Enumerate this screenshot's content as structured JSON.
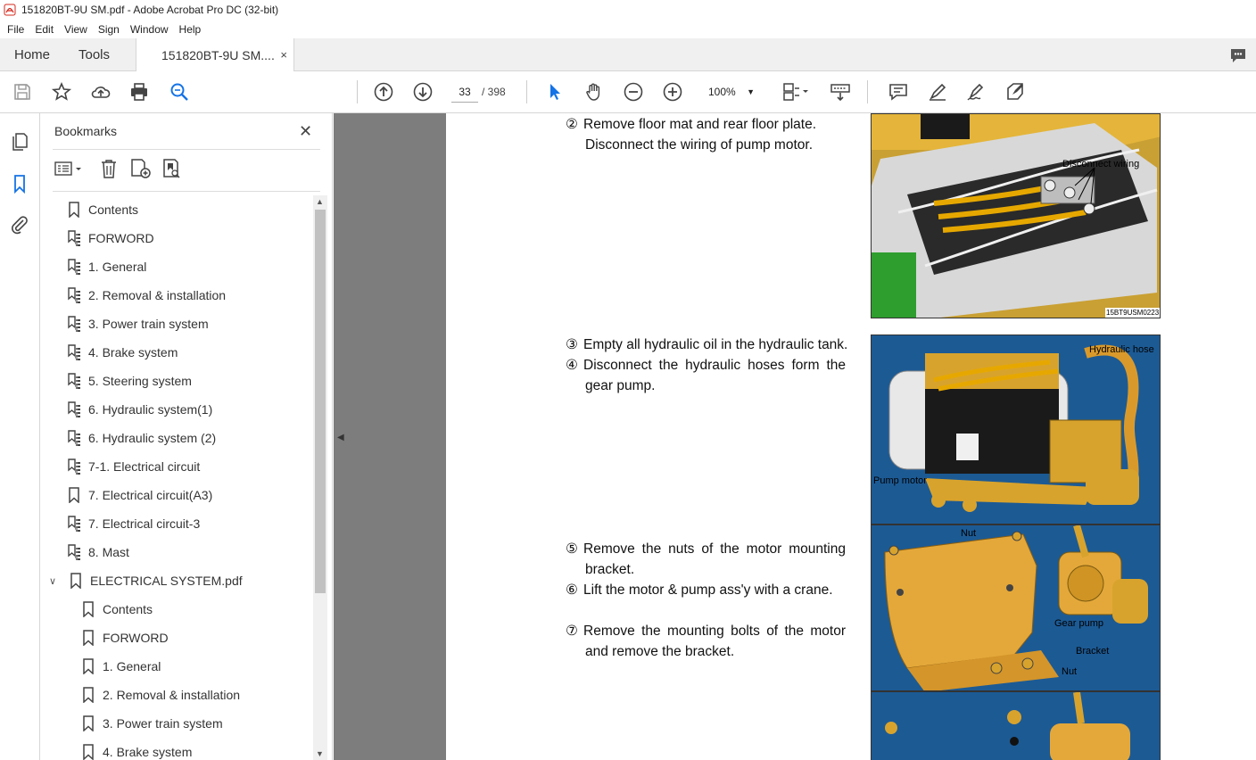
{
  "window": {
    "title": "151820BT-9U SM.pdf - Adobe Acrobat Pro DC (32-bit)"
  },
  "menu": [
    "File",
    "Edit",
    "View",
    "Sign",
    "Window",
    "Help"
  ],
  "tabs": {
    "home": "Home",
    "tools": "Tools",
    "document": "151820BT-9U SM....",
    "close": "×"
  },
  "toolbar": {
    "page_current": "33",
    "page_total": "/ 398",
    "zoom": "100%"
  },
  "bookmarks": {
    "title": "Bookmarks",
    "items": [
      {
        "label": "Contents",
        "icon": "bookmark-icon"
      },
      {
        "label": "FORWORD",
        "icon": "bookmark-tree-icon"
      },
      {
        "label": "1. General",
        "icon": "bookmark-tree-icon"
      },
      {
        "label": "2. Removal & installation",
        "icon": "bookmark-tree-icon"
      },
      {
        "label": "3. Power train system",
        "icon": "bookmark-tree-icon"
      },
      {
        "label": "4. Brake system",
        "icon": "bookmark-tree-icon"
      },
      {
        "label": "5. Steering system",
        "icon": "bookmark-tree-icon"
      },
      {
        "label": "6. Hydraulic system(1)",
        "icon": "bookmark-tree-icon"
      },
      {
        "label": "6. Hydraulic system (2)",
        "icon": "bookmark-tree-icon"
      },
      {
        "label": "7-1. Electrical circuit",
        "icon": "bookmark-tree-icon"
      },
      {
        "label": "7. Electrical circuit(A3)",
        "icon": "bookmark-icon"
      },
      {
        "label": "7. Electrical circuit-3",
        "icon": "bookmark-tree-icon"
      },
      {
        "label": "8. Mast",
        "icon": "bookmark-tree-icon"
      },
      {
        "label": "ELECTRICAL SYSTEM.pdf",
        "icon": "bookmark-icon",
        "expanded": true
      },
      {
        "label": "Contents",
        "icon": "bookmark-icon"
      },
      {
        "label": "FORWORD",
        "icon": "bookmark-icon"
      },
      {
        "label": "1. General",
        "icon": "bookmark-icon"
      },
      {
        "label": "2. Removal & installation",
        "icon": "bookmark-icon"
      },
      {
        "label": "3. Power train system",
        "icon": "bookmark-icon"
      },
      {
        "label": "4. Brake system",
        "icon": "bookmark-icon"
      }
    ]
  },
  "document": {
    "steps": [
      {
        "num": "②",
        "lines": [
          "Remove floor mat and rear floor plate.",
          "Disconnect the wiring of pump motor."
        ]
      },
      {
        "num": "③",
        "lines": [
          "Empty all hydraulic oil in the hydraulic tank."
        ]
      },
      {
        "num": "④",
        "lines": [
          "Disconnect the hydraulic hoses form the",
          "gear pump."
        ]
      },
      {
        "num": "⑤",
        "lines": [
          "Remove the nuts of the motor mounting",
          "bracket."
        ]
      },
      {
        "num": "⑥",
        "lines": [
          "Lift the motor & pump ass'y with a crane."
        ]
      },
      {
        "num": "⑦",
        "lines": [
          "Remove the mounting bolts of the motor",
          "and remove the bracket."
        ]
      }
    ],
    "figures": {
      "fig1": {
        "label": "Disconnect wiring",
        "code": "15BT9USM0223"
      },
      "fig2": {
        "hose": "Hydraulic hose",
        "motor": "Pump motor"
      },
      "fig3": {
        "nut_top": "Nut",
        "gear": "Gear pump",
        "bracket": "Bracket",
        "nut_bottom": "Nut"
      }
    }
  }
}
